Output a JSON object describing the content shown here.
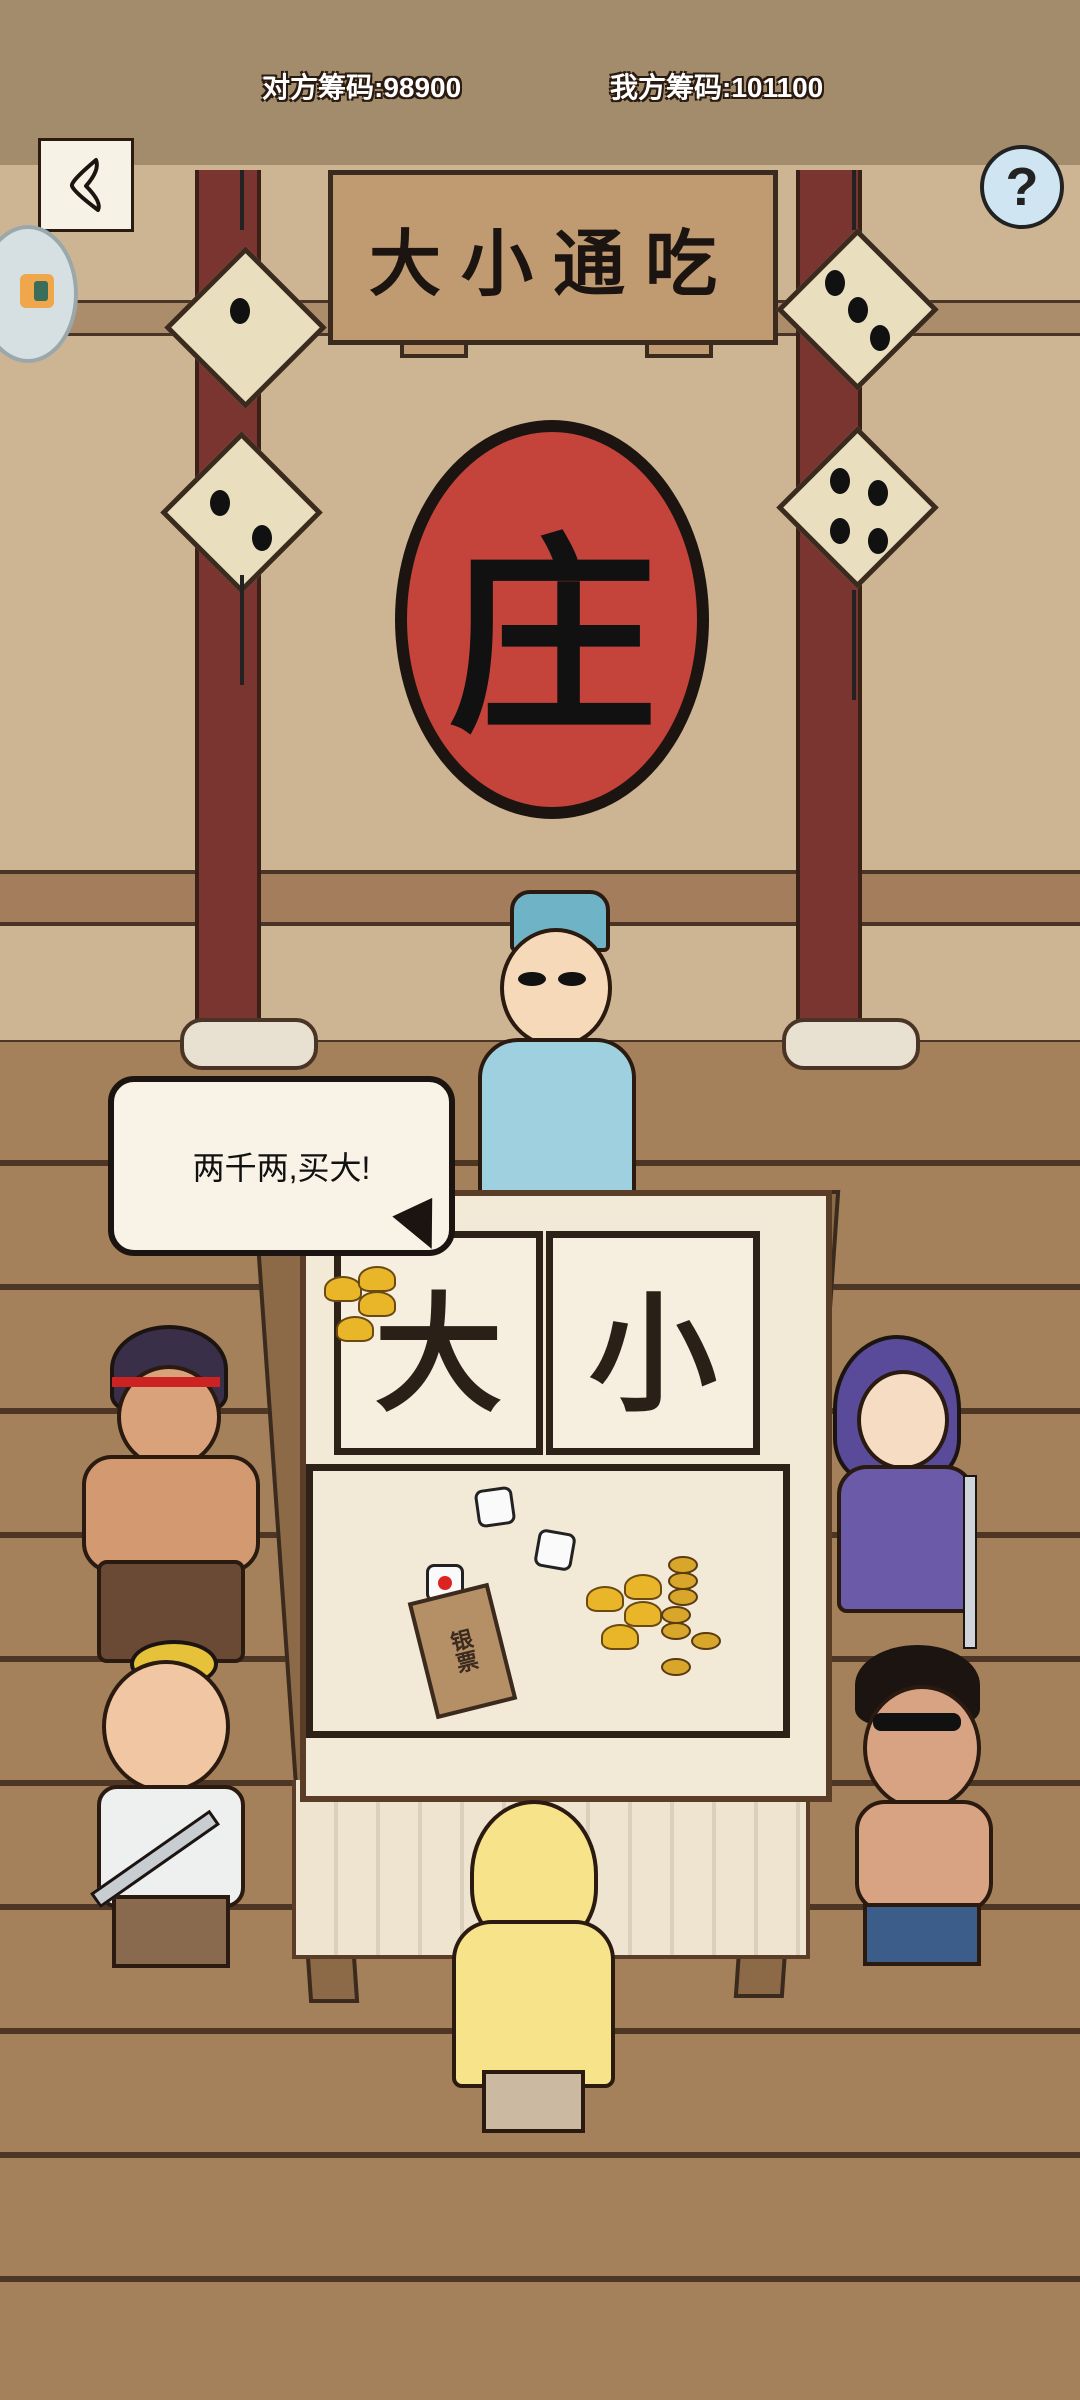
{
  "hud": {
    "opponent_chips_label": "对方筹码:",
    "opponent_chips_value": "98900",
    "my_chips_label": "我方筹码:",
    "my_chips_value": "101100"
  },
  "sign": {
    "title": "大小通吃"
  },
  "emblem": {
    "character": "庄"
  },
  "speech": {
    "text": "两千两,买大!"
  },
  "table": {
    "zone_big_label": "大",
    "zone_small_label": "小",
    "banknote_label": "银票"
  },
  "icons": {
    "back": "back-arrow-icon",
    "help": "question-mark-icon",
    "side_badge": "app-badge-icon"
  },
  "colors": {
    "emblem_red": "#c4433a",
    "pillar_red": "#7a3530",
    "gold": "#e9b62a",
    "help_blue": "#cfe6f2"
  }
}
